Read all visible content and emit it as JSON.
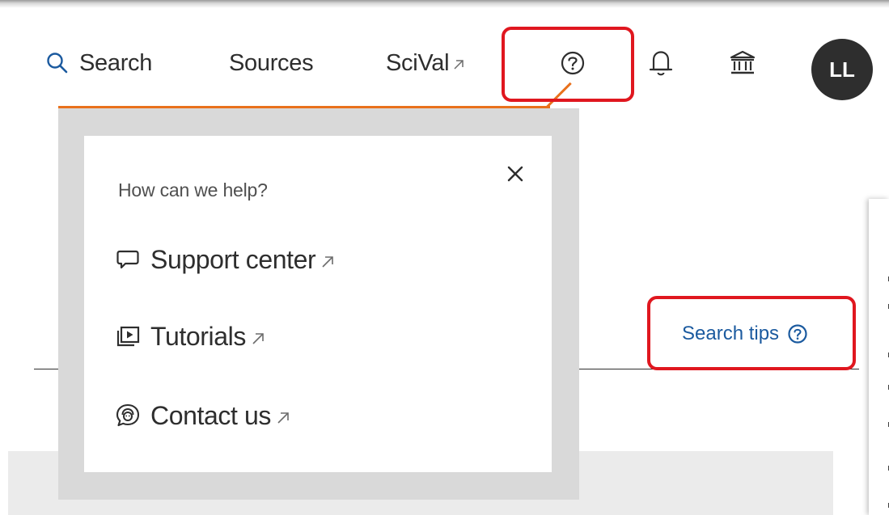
{
  "nav": {
    "search_label": "Search",
    "sources_label": "Sources",
    "scival_label": "SciVal",
    "avatar_initials": "LL",
    "accent_color": "#e9711c",
    "link_color": "#1b5a9f",
    "annotation_color": "#e0171f"
  },
  "help_menu": {
    "heading": "How can we help?",
    "close_icon": "close-icon",
    "items": [
      {
        "label": "Support center",
        "icon": "chat-bubble-icon"
      },
      {
        "label": "Tutorials",
        "icon": "video-library-icon"
      },
      {
        "label": "Contact us",
        "icon": "contact-support-icon"
      }
    ]
  },
  "search_tips": {
    "label": "Search tips",
    "icon": "question-circle-icon"
  }
}
